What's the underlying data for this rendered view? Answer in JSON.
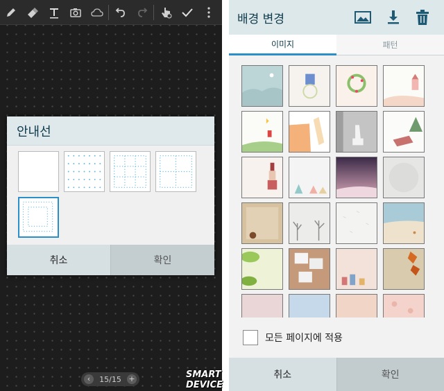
{
  "toolbar": {
    "icons": [
      "pen-icon",
      "eraser-icon",
      "text-icon",
      "camera-icon",
      "cloud-icon",
      "undo-icon",
      "redo-icon",
      "touch-select-icon",
      "check-icon",
      "more-icon"
    ]
  },
  "guide_dialog": {
    "title": "안내선",
    "options": [
      "none",
      "dots-fine",
      "dots-grid-3",
      "dots-grid-2",
      "dots-frame"
    ],
    "selected_option": "dots-frame",
    "cancel_label": "취소",
    "ok_label": "확인"
  },
  "pager": {
    "label": "15/15"
  },
  "watermark": {
    "text": "SMART DEVICE"
  },
  "bg_dialog": {
    "title": "배경 변경",
    "tabs": [
      "이미지",
      "패턴"
    ],
    "active_tab": "이미지",
    "thumbnails": [
      "sky-moon",
      "blue-building",
      "wreath",
      "church-flowers",
      "kite-girl",
      "pencil-paper",
      "deer-curtain",
      "christmas-tree",
      "gift-stack",
      "tents",
      "purple-night",
      "gray-texture",
      "kraft-paper",
      "winter-trees",
      "white-texture",
      "beach",
      "green-leaves",
      "photo-collage",
      "town-sunset",
      "autumn-leaves",
      "pink-sky",
      "blue-sky",
      "peach-sky",
      "floral-pink"
    ],
    "apply_all_label": "모든 페이지에 적용",
    "cancel_label": "취소",
    "ok_label": "확인"
  },
  "colors": {
    "accent": "#2a8fc8",
    "header_bg": "#dde8eb",
    "dark_bg": "#1d1d1d"
  }
}
